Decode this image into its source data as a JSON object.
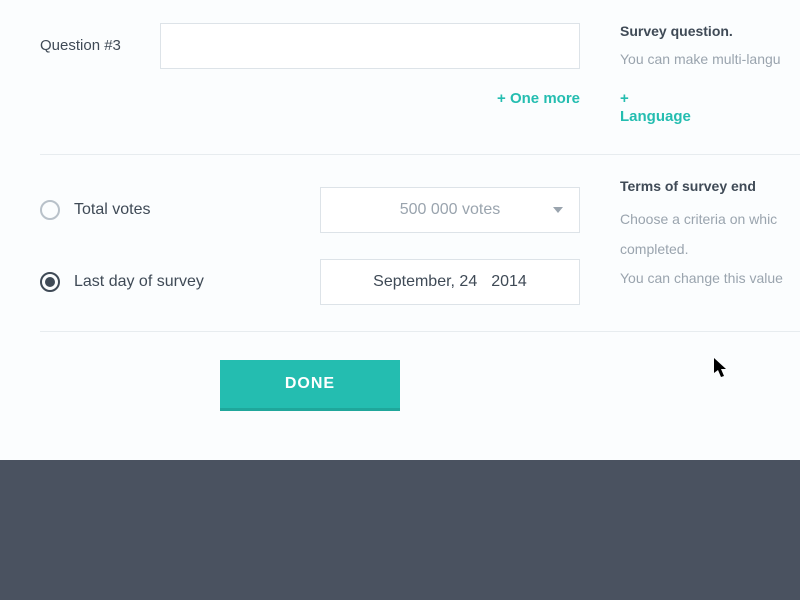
{
  "question": {
    "label": "Question #3",
    "value": "",
    "help_title": "Survey question.",
    "help_body": "You can make multi-langu",
    "one_more": "+ One more",
    "language": "+ Language"
  },
  "criteria": {
    "total_votes_label": "Total votes",
    "last_day_label": "Last day of survey",
    "votes_select": "500 000 votes",
    "date_month_day": "September, 24",
    "date_year": "2014",
    "help_title": "Terms of survey end",
    "help_line1": "Choose a criteria on whic",
    "help_line2": "completed.",
    "help_line3": "You can change this value"
  },
  "done_label": "DONE"
}
